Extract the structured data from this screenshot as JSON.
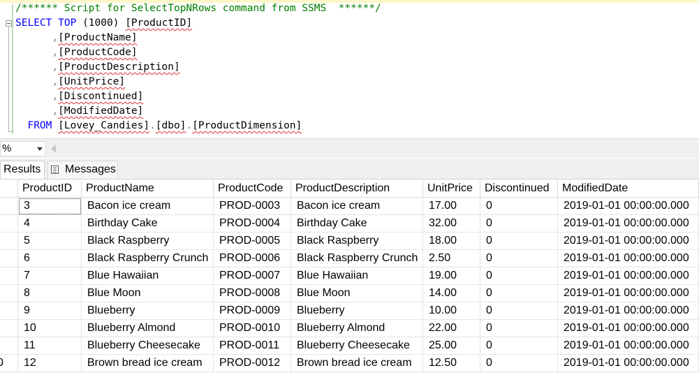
{
  "editor": {
    "comment": "/****** Script for SelectTopNRows command from SSMS  ******/",
    "select_keyword": "SELECT",
    "top_keyword": "TOP",
    "top_value": "(1000)",
    "first_column": "[ProductID]",
    "columns": [
      "[ProductName]",
      "[ProductCode]",
      "[ProductDescription]",
      "[UnitPrice]",
      "[Discontinued]",
      "[ModifiedDate]"
    ],
    "from_keyword": "FROM",
    "table": {
      "database": "[Lovey_Candies]",
      "schema": "[dbo]",
      "name": "[ProductDimension]"
    }
  },
  "zoom": {
    "value": "%"
  },
  "tabs": {
    "results": "Results",
    "messages": "Messages"
  },
  "grid": {
    "columns": [
      "ProductID",
      "ProductName",
      "ProductCode",
      "ProductDescription",
      "UnitPrice",
      "Discontinued",
      "ModifiedDate"
    ],
    "rows": [
      {
        "num": "",
        "cells": [
          "3",
          "Bacon ice cream",
          "PROD-0003",
          "Bacon ice cream",
          "17.00",
          "0",
          "2019-01-01 00:00:00.000"
        ]
      },
      {
        "num": "",
        "cells": [
          "4",
          "Birthday Cake",
          "PROD-0004",
          "Birthday Cake",
          "32.00",
          "0",
          "2019-01-01 00:00:00.000"
        ]
      },
      {
        "num": "",
        "cells": [
          "5",
          "Black Raspberry",
          "PROD-0005",
          "Black Raspberry",
          "18.00",
          "0",
          "2019-01-01 00:00:00.000"
        ]
      },
      {
        "num": "",
        "cells": [
          "6",
          "Black Raspberry Crunch",
          "PROD-0006",
          "Black Raspberry Crunch",
          "2.50",
          "0",
          "2019-01-01 00:00:00.000"
        ]
      },
      {
        "num": "",
        "cells": [
          "7",
          "Blue Hawaiian",
          "PROD-0007",
          "Blue Hawaiian",
          "19.00",
          "0",
          "2019-01-01 00:00:00.000"
        ]
      },
      {
        "num": "",
        "cells": [
          "8",
          "Blue Moon",
          "PROD-0008",
          "Blue Moon",
          "14.00",
          "0",
          "2019-01-01 00:00:00.000"
        ]
      },
      {
        "num": "",
        "cells": [
          "9",
          "Blueberry",
          "PROD-0009",
          "Blueberry",
          "10.00",
          "0",
          "2019-01-01 00:00:00.000"
        ]
      },
      {
        "num": "",
        "cells": [
          "10",
          "Blueberry Almond",
          "PROD-0010",
          "Blueberry Almond",
          "22.00",
          "0",
          "2019-01-01 00:00:00.000"
        ]
      },
      {
        "num": "",
        "cells": [
          "11",
          "Blueberry Cheesecake",
          "PROD-0011",
          "Blueberry Cheesecake",
          "25.00",
          "0",
          "2019-01-01 00:00:00.000"
        ]
      },
      {
        "num": "0",
        "cells": [
          "12",
          "Brown bread ice cream",
          "PROD-0012",
          "Brown bread ice cream",
          "12.50",
          "0",
          "2019-01-01 00:00:00.000"
        ]
      }
    ]
  }
}
